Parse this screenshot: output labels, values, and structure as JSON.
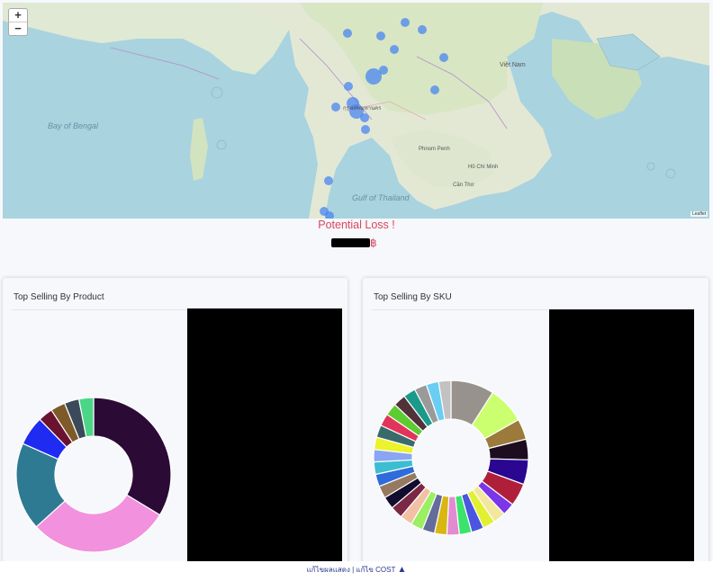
{
  "map": {
    "zoom_in_label": "+",
    "zoom_out_label": "−",
    "labels": {
      "bay_of_bengal": "Bay of Bengal",
      "gulf_of_thailand": "Gulf of Thailand",
      "viet_nam": "Việt Nam",
      "phnom_penh": "Phnom Penh",
      "ho_chi_minh": "Hồ Chí Minh",
      "can_tho": "Cần Thơ",
      "bangkok": "กรุงเทพมหานคร"
    },
    "attribution": "Leaflet",
    "marker_color": "#4a86f0"
  },
  "loss": {
    "title": "Potential Loss !",
    "currency_symbol": "฿"
  },
  "product_card": {
    "title": "Top Selling By Product"
  },
  "sku_card": {
    "title": "Top Selling By SKU"
  },
  "footer": {
    "link1": "แก้ไขผลแสดง",
    "separator": " | ",
    "link2": "แก้ไข COST"
  },
  "chart_data": [
    {
      "type": "pie",
      "values": [
        33,
        29,
        18,
        6,
        3,
        3,
        3,
        3
      ],
      "colors": [
        "#2c0a36",
        "#f291dd",
        "#2e7a93",
        "#1f2bf0",
        "#6b1230",
        "#7d5a28",
        "#3a4a58",
        "#4bd687"
      ]
    },
    {
      "type": "pie",
      "values": [
        10.5,
        9,
        5,
        5,
        6,
        5.5,
        3,
        3,
        3,
        3,
        3,
        3,
        3,
        3,
        3,
        3,
        3,
        3,
        3,
        3,
        3,
        3,
        3,
        3,
        3,
        3,
        3,
        3,
        3,
        3,
        3
      ],
      "colors": [
        "#97938c",
        "#cbff6f",
        "#9c7a3c",
        "#1e0c1f",
        "#2a0691",
        "#b01f3a",
        "#7a36e8",
        "#f2e79d",
        "#e2f032",
        "#4a56e0",
        "#3ae36c",
        "#e28bd0",
        "#d8b712",
        "#636c9b",
        "#9aef62",
        "#f2c0a5",
        "#7a2843",
        "#120d2e",
        "#967a5f",
        "#2e6bdc",
        "#3bbed0",
        "#8aa5f2",
        "#ecf22b",
        "#3a6b6b",
        "#e2345a",
        "#5dcc31",
        "#523138",
        "#1a9a8a",
        "#9a9a9a",
        "#6acdf2",
        "#c2c2c2"
      ]
    }
  ]
}
